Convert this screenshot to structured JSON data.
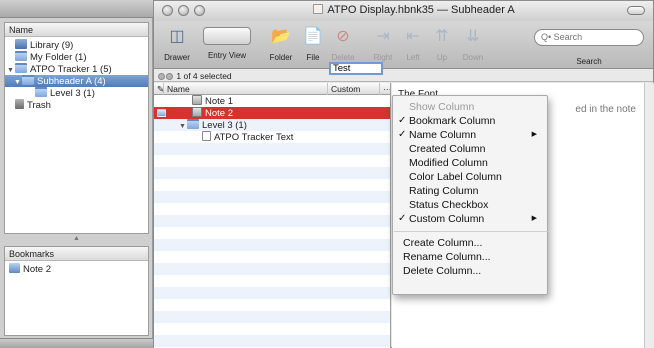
{
  "window": {
    "title": "ATPO Display.hbnk35 — Subheader A"
  },
  "toolbar": {
    "drawer": "Drawer",
    "entry_view": "Entry View",
    "folder": "Folder",
    "file": "File",
    "delete": "Delete",
    "right": "Right",
    "left": "Left",
    "up": "Up",
    "down": "Down",
    "search_placeholder": "Q• Search",
    "search_label": "Search"
  },
  "status": {
    "text": "1 of 4 selected"
  },
  "sidebar": {
    "header": "Name",
    "items": [
      {
        "label": "Library (9)",
        "icon": "library-icon"
      },
      {
        "label": "My Folder (1)",
        "icon": "folder-icon"
      },
      {
        "label": "ATPO Tracker 1 (5)",
        "icon": "folder-icon"
      },
      {
        "label": "Subheader A (4)",
        "icon": "folder-icon",
        "selected": true
      },
      {
        "label": "Level 3 (1)",
        "icon": "folder-icon"
      },
      {
        "label": "Trash",
        "icon": "trash-icon"
      }
    ]
  },
  "bookmarks": {
    "header": "Bookmarks",
    "items": [
      {
        "label": "Note 2",
        "icon": "bookmark-icon"
      }
    ]
  },
  "outline": {
    "columns": {
      "name": "Name",
      "custom": "Custom",
      "more": "···"
    },
    "rows": [
      {
        "name": "Note 1",
        "custom": ""
      },
      {
        "name": "Note 2",
        "custom": "Test",
        "selected": true
      },
      {
        "name": "Level 3 (1)",
        "custom": ""
      },
      {
        "name": "ATPO Tracker Text",
        "custom": ""
      }
    ]
  },
  "note": {
    "title": "The Font",
    "body": "ed in the note"
  },
  "context_menu": {
    "items": [
      {
        "label": "Show Column",
        "checked": false,
        "disabled": true
      },
      {
        "label": "Bookmark Column",
        "checked": true
      },
      {
        "label": "Name Column",
        "checked": true,
        "submenu": true
      },
      {
        "label": "Created Column"
      },
      {
        "label": "Modified Column"
      },
      {
        "label": "Color Label Column"
      },
      {
        "label": "Rating Column"
      },
      {
        "label": "Status Checkbox"
      },
      {
        "label": "Custom Column",
        "checked": true,
        "submenu": true
      },
      {
        "label": "Create Column..."
      },
      {
        "label": "Rename Column..."
      },
      {
        "label": "Delete Column..."
      }
    ]
  },
  "colors": {
    "selection_red": "#d6332f",
    "sidebar_selection": "#4f7cbd",
    "accent_blue": "#6f9bd8"
  }
}
